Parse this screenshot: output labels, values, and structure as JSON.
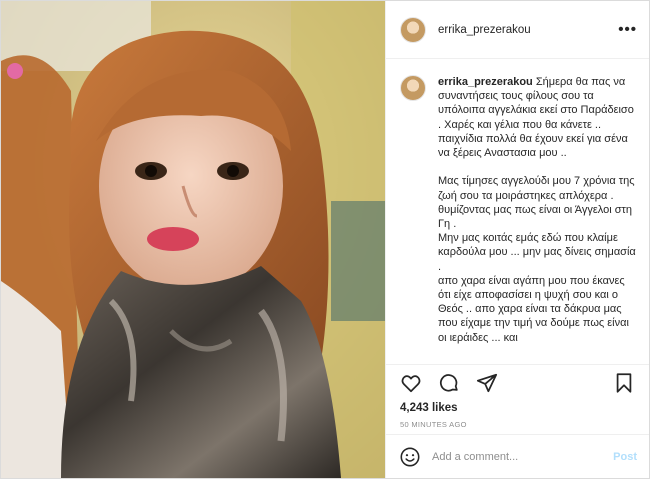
{
  "post": {
    "photo_alt": "Portrait photo",
    "author": "errika_prezerakou",
    "more_icon": "more-horizontal-icon",
    "caption": {
      "username": "errika_prezerakou",
      "text": " Σήμερα θα πας να συναντήσεις τους φίλους σου τα υπόλοιπα αγγελάκια εκεί στο Παράδεισο . Χαρές και γέλια που θα κάνετε .. παιχνίδια πολλά θα έχουν εκεί για σένα να ξέρεις Αναστασια μου ..\n\nΜας τίμησες αγγελούδι μου 7 χρόνια της ζωή σου τα μοιράστηκες απλόχερα . θυμίζοντας μας πως είναι οι Άγγελοι στη Γη .\nΜην μας κοιτάς εμάς εδώ που κλαίμε καρδούλα μου ... μην μας δίνεις σημασία .\nαπο χαρα είναι αγάπη μου που έκανες ότι είχε αποφασίσει η ψυχή σου και ο Θεός .. απο χαρα είναι τα δάκρυα μας που είχαμε την τιμή να δούμε πως είναι οι ιεράιδες ... και"
    },
    "likes": "4,243 likes",
    "timestamp": "50 MINUTES AGO",
    "comment": {
      "placeholder": "Add a comment...",
      "post_label": "Post"
    },
    "colors": {
      "text": "#262626",
      "muted": "#8e8e8e",
      "post_button": "#b2dffc",
      "border": "#dbdbdb"
    }
  }
}
